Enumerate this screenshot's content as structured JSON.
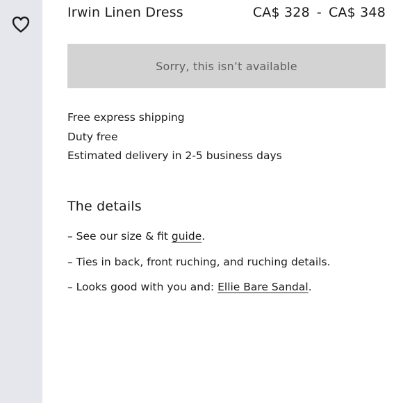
{
  "wishlist": {
    "icon": "heart-outline-icon"
  },
  "product": {
    "name": "Irwin Linen Dress",
    "price_min": "CA$ 328",
    "price_separator": "-",
    "price_max": "CA$ 348",
    "unavailable_label": "Sorry, this isn’t available"
  },
  "shipping": {
    "lines": [
      "Free express shipping",
      "Duty free",
      "Estimated delivery in 2-5 business days"
    ]
  },
  "details": {
    "title": "The details",
    "items": [
      {
        "prefix": "– See our size & fit ",
        "link": "guide",
        "suffix": "."
      },
      {
        "text": "– Ties in back, front ruching, and ruching details."
      },
      {
        "prefix": "– Looks good with you and: ",
        "link": "Ellie Bare Sandal",
        "suffix": "."
      }
    ]
  },
  "colors": {
    "rail": "#e6e7ec",
    "button_bg": "#d3d3d3",
    "button_text": "#5e5e5e",
    "text": "#1a1a1a"
  }
}
